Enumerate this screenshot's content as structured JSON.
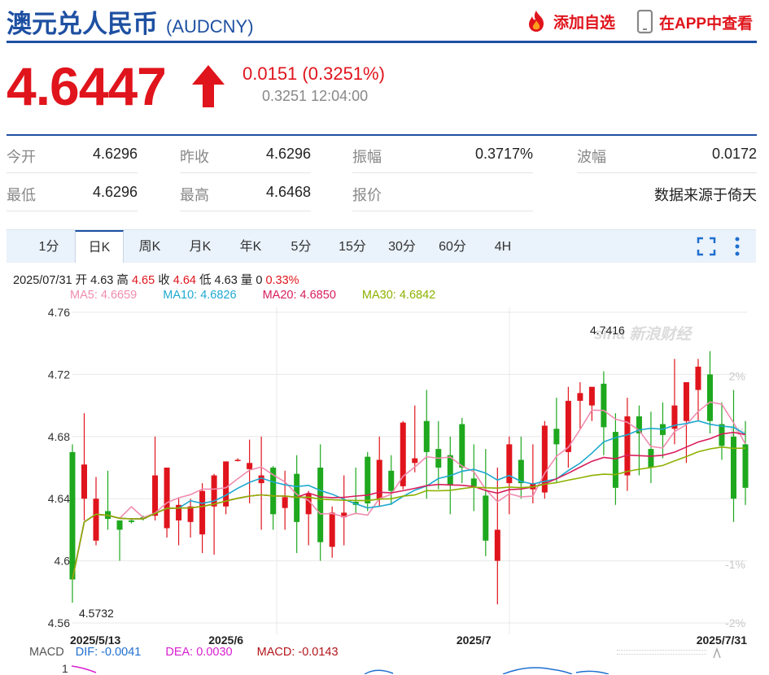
{
  "header": {
    "title": "澳元兑人民币",
    "code": "(AUDCNY)",
    "add_watchlist": "添加自选",
    "view_in_app": "在APP中查看"
  },
  "quote": {
    "price": "4.6447",
    "change": "0.0151",
    "change_pct": "(0.3251%)",
    "sub_value": "0.3251",
    "time": "12:04:00"
  },
  "stats": [
    {
      "label": "今开",
      "value": "4.6296"
    },
    {
      "label": "昨收",
      "value": "4.6296"
    },
    {
      "label": "振幅",
      "value": "0.3717%"
    },
    {
      "label": "波幅",
      "value": "0.0172"
    },
    {
      "label": "最低",
      "value": "4.6296"
    },
    {
      "label": "最高",
      "value": "4.6468"
    },
    {
      "label": "报价",
      "value": "数据来源于倚天"
    }
  ],
  "tabs": [
    "1分",
    "日K",
    "周K",
    "月K",
    "年K",
    "5分",
    "15分",
    "30分",
    "60分",
    "4H"
  ],
  "active_tab": "日K",
  "ohlc": {
    "date": "2025/07/31",
    "open_label": "开",
    "open": "4.63",
    "high_label": "高",
    "high": "4.65",
    "close_label": "收",
    "close": "4.64",
    "low_label": "低",
    "low": "4.63",
    "vol_label": "量",
    "vol": "0",
    "pct": "0.33%"
  },
  "ma": [
    {
      "label": "MA5: 4.6659",
      "color": "#f08cb0"
    },
    {
      "label": "MA10: 4.6826",
      "color": "#1ea9d0"
    },
    {
      "label": "MA20: 4.6850",
      "color": "#d81e5b"
    },
    {
      "label": "MA30: 4.6842",
      "color": "#8db100"
    }
  ],
  "macd": {
    "label": "MACD",
    "dif": "DIF: -0.0041",
    "dea": "DEA: 0.0030",
    "macd": "MACD: -0.0143",
    "axis_top": "1"
  },
  "chart_data": {
    "type": "candlestick",
    "y_ticks": [
      "4.76",
      "4.72",
      "4.68",
      "4.64",
      "4.6",
      "4.56"
    ],
    "y_tick_values": [
      4.76,
      4.72,
      4.68,
      4.64,
      4.6,
      4.56
    ],
    "ylim": [
      4.56,
      4.76
    ],
    "right_ticks": [
      "2%",
      "1%",
      "-1%",
      "-2%"
    ],
    "right_tick_values": [
      4.7188,
      4.6834,
      4.5976,
      4.56
    ],
    "x_labels": [
      {
        "label": "2025/5/13",
        "index": 0
      },
      {
        "label": "2025/6",
        "index": 13
      },
      {
        "label": "2025/7",
        "index": 34
      },
      {
        "label": "2025/7/31",
        "index": 51
      }
    ],
    "annotations": [
      {
        "text": "4.7416",
        "index": 46,
        "value": 4.7416
      },
      {
        "text": "4.5732",
        "index": 0,
        "value": 4.5732
      }
    ],
    "watermark": "sina 新浪财经",
    "candles": [
      {
        "o": 4.67,
        "h": 4.675,
        "l": 4.573,
        "c": 4.588
      },
      {
        "o": 4.64,
        "h": 4.695,
        "l": 4.626,
        "c": 4.662
      },
      {
        "o": 4.613,
        "h": 4.654,
        "l": 4.61,
        "c": 4.64
      },
      {
        "o": 4.632,
        "h": 4.658,
        "l": 4.62,
        "c": 4.627
      },
      {
        "o": 4.626,
        "h": 4.626,
        "l": 4.6,
        "c": 4.62
      },
      {
        "o": 4.626,
        "h": 4.627,
        "l": 4.624,
        "c": 4.625
      },
      {
        "o": 4.628,
        "h": 4.629,
        "l": 4.626,
        "c": 4.627
      },
      {
        "o": 4.629,
        "h": 4.68,
        "l": 4.626,
        "c": 4.655
      },
      {
        "o": 4.621,
        "h": 4.66,
        "l": 4.615,
        "c": 4.66
      },
      {
        "o": 4.626,
        "h": 4.64,
        "l": 4.61,
        "c": 4.636
      },
      {
        "o": 4.625,
        "h": 4.64,
        "l": 4.615,
        "c": 4.635
      },
      {
        "o": 4.617,
        "h": 4.65,
        "l": 4.605,
        "c": 4.645
      },
      {
        "o": 4.635,
        "h": 4.656,
        "l": 4.604,
        "c": 4.655
      },
      {
        "o": 4.635,
        "h": 4.663,
        "l": 4.63,
        "c": 4.664
      },
      {
        "o": 4.665,
        "h": 4.666,
        "l": 4.664,
        "c": 4.665
      },
      {
        "o": 4.659,
        "h": 4.678,
        "l": 4.637,
        "c": 4.663
      },
      {
        "o": 4.65,
        "h": 4.68,
        "l": 4.62,
        "c": 4.655
      },
      {
        "o": 4.66,
        "h": 4.661,
        "l": 4.62,
        "c": 4.63
      },
      {
        "o": 4.634,
        "h": 4.658,
        "l": 4.62,
        "c": 4.641
      },
      {
        "o": 4.656,
        "h": 4.668,
        "l": 4.605,
        "c": 4.625
      },
      {
        "o": 4.63,
        "h": 4.645,
        "l": 4.61,
        "c": 4.643
      },
      {
        "o": 4.66,
        "h": 4.675,
        "l": 4.6,
        "c": 4.612
      },
      {
        "o": 4.609,
        "h": 4.635,
        "l": 4.602,
        "c": 4.631
      },
      {
        "o": 4.628,
        "h": 4.655,
        "l": 4.61,
        "c": 4.631
      },
      {
        "o": 4.638,
        "h": 4.66,
        "l": 4.63,
        "c": 4.636
      },
      {
        "o": 4.667,
        "h": 4.67,
        "l": 4.632,
        "c": 4.637
      },
      {
        "o": 4.64,
        "h": 4.68,
        "l": 4.635,
        "c": 4.665
      },
      {
        "o": 4.658,
        "h": 4.668,
        "l": 4.636,
        "c": 4.645
      },
      {
        "o": 4.648,
        "h": 4.69,
        "l": 4.646,
        "c": 4.689
      },
      {
        "o": 4.663,
        "h": 4.7,
        "l": 4.657,
        "c": 4.666
      },
      {
        "o": 4.69,
        "h": 4.71,
        "l": 4.64,
        "c": 4.67
      },
      {
        "o": 4.672,
        "h": 4.69,
        "l": 4.646,
        "c": 4.66
      },
      {
        "o": 4.668,
        "h": 4.68,
        "l": 4.63,
        "c": 4.649
      },
      {
        "o": 4.688,
        "h": 4.692,
        "l": 4.65,
        "c": 4.66
      },
      {
        "o": 4.653,
        "h": 4.675,
        "l": 4.632,
        "c": 4.648
      },
      {
        "o": 4.642,
        "h": 4.672,
        "l": 4.603,
        "c": 4.613
      },
      {
        "o": 4.6,
        "h": 4.66,
        "l": 4.572,
        "c": 4.62
      },
      {
        "o": 4.65,
        "h": 4.68,
        "l": 4.63,
        "c": 4.675
      },
      {
        "o": 4.665,
        "h": 4.68,
        "l": 4.64,
        "c": 4.65
      },
      {
        "o": 4.646,
        "h": 4.675,
        "l": 4.637,
        "c": 4.65
      },
      {
        "o": 4.644,
        "h": 4.69,
        "l": 4.64,
        "c": 4.687
      },
      {
        "o": 4.685,
        "h": 4.705,
        "l": 4.65,
        "c": 4.675
      },
      {
        "o": 4.67,
        "h": 4.712,
        "l": 4.66,
        "c": 4.703
      },
      {
        "o": 4.703,
        "h": 4.715,
        "l": 4.685,
        "c": 4.708
      },
      {
        "o": 4.7,
        "h": 4.712,
        "l": 4.69,
        "c": 4.712
      },
      {
        "o": 4.714,
        "h": 4.722,
        "l": 4.668,
        "c": 4.686
      },
      {
        "o": 4.683,
        "h": 4.695,
        "l": 4.636,
        "c": 4.647
      },
      {
        "o": 4.655,
        "h": 4.705,
        "l": 4.645,
        "c": 4.693
      },
      {
        "o": 4.693,
        "h": 4.7,
        "l": 4.655,
        "c": 4.682
      },
      {
        "o": 4.672,
        "h": 4.696,
        "l": 4.65,
        "c": 4.66
      },
      {
        "o": 4.688,
        "h": 4.702,
        "l": 4.666,
        "c": 4.681
      },
      {
        "o": 4.685,
        "h": 4.73,
        "l": 4.675,
        "c": 4.7
      },
      {
        "o": 4.69,
        "h": 4.715,
        "l": 4.663,
        "c": 4.715
      },
      {
        "o": 4.71,
        "h": 4.73,
        "l": 4.69,
        "c": 4.725
      },
      {
        "o": 4.72,
        "h": 4.735,
        "l": 4.682,
        "c": 4.69
      },
      {
        "o": 4.688,
        "h": 4.702,
        "l": 4.665,
        "c": 4.674
      },
      {
        "o": 4.68,
        "h": 4.71,
        "l": 4.625,
        "c": 4.64
      },
      {
        "o": 4.675,
        "h": 4.69,
        "l": 4.636,
        "c": 4.647
      }
    ]
  }
}
